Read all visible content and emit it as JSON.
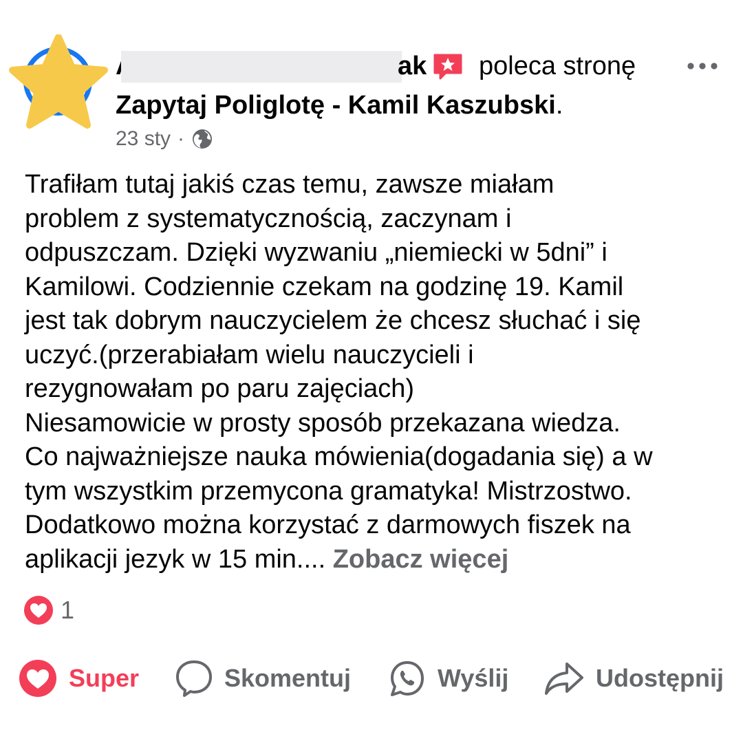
{
  "post": {
    "author_visible_prefix": "A",
    "author_visible_suffix": "ak",
    "action_text": "poleca stronę",
    "page_name": "Zapytaj Poliglotę - Kamil Kaszubski",
    "page_name_suffix": ".",
    "date": "23 sty",
    "separator": "·",
    "body_lines": [
      "Trafiłam tutaj jakiś czas temu, zawsze miałam",
      "problem z systematycznością, zaczynam i",
      "odpuszczam. Dzięki wyzwaniu „niemiecki w 5dni” i",
      "Kamilowi. Codziennie czekam na godzinę 19. Kamil",
      "jest tak dobrym nauczycielem że chcesz słuchać i się",
      "uczyć.(przerabiałam wielu nauczycieli i",
      "rezygnowałam po paru zajęciach)",
      "Niesamowicie w prosty sposób przekazana wiedza.",
      "Co najważniejsze nauka mówienia(dogadania się) a w",
      "tym wszystkim przemycona gramatyka! Mistrzostwo.",
      "Dodatkowo można korzystać z darmowych fiszek na"
    ],
    "body_last_line": "aplikacji jezyk w 15 min....",
    "see_more": "Zobacz więcej",
    "reaction_count": "1"
  },
  "actions": {
    "super": "Super",
    "comment": "Skomentuj",
    "send": "Wyślij",
    "share": "Udostępnij"
  },
  "colors": {
    "primary_text": "#050505",
    "secondary_text": "#65676b",
    "love_red": "#f33e58",
    "avatar_ring": "#1877f2",
    "star": "#f7c94b"
  },
  "icons": {
    "avatar": "star-avatar",
    "badge": "recommend-star-badge",
    "more": "more-dots-icon",
    "audience": "globe-icon",
    "reaction": "heart-icon",
    "comment": "comment-bubble-icon",
    "send": "whatsapp-icon",
    "share": "share-arrow-icon"
  }
}
